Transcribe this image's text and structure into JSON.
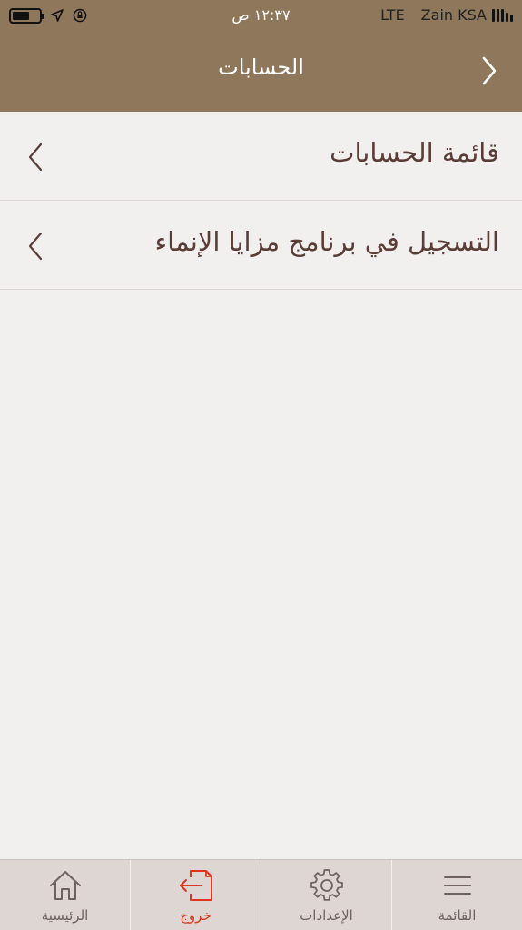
{
  "status_bar": {
    "time": "١٢:٣٧ ص",
    "network": "LTE",
    "carrier": "Zain KSA"
  },
  "nav": {
    "title": "الحسابات",
    "back_icon": "chevron-right-icon"
  },
  "list": {
    "items": [
      {
        "label": "قائمة الحسابات",
        "icon": "chevron-left-icon"
      },
      {
        "label": "التسجيل في برنامج مزايا الإنماء",
        "icon": "chevron-left-icon"
      }
    ]
  },
  "tab_bar": {
    "tabs": [
      {
        "label": "الرئيسية",
        "icon": "home-icon"
      },
      {
        "label": "خروج",
        "icon": "logout-icon",
        "active": true
      },
      {
        "label": "الإعدادات",
        "icon": "gear-icon"
      },
      {
        "label": "القائمة",
        "icon": "menu-icon"
      }
    ]
  },
  "colors": {
    "header": "#8e775a",
    "active_tab": "#e0331e",
    "text": "#5a3d36",
    "background": "#f2f0ef",
    "tab_bar": "#ddd6d2"
  }
}
